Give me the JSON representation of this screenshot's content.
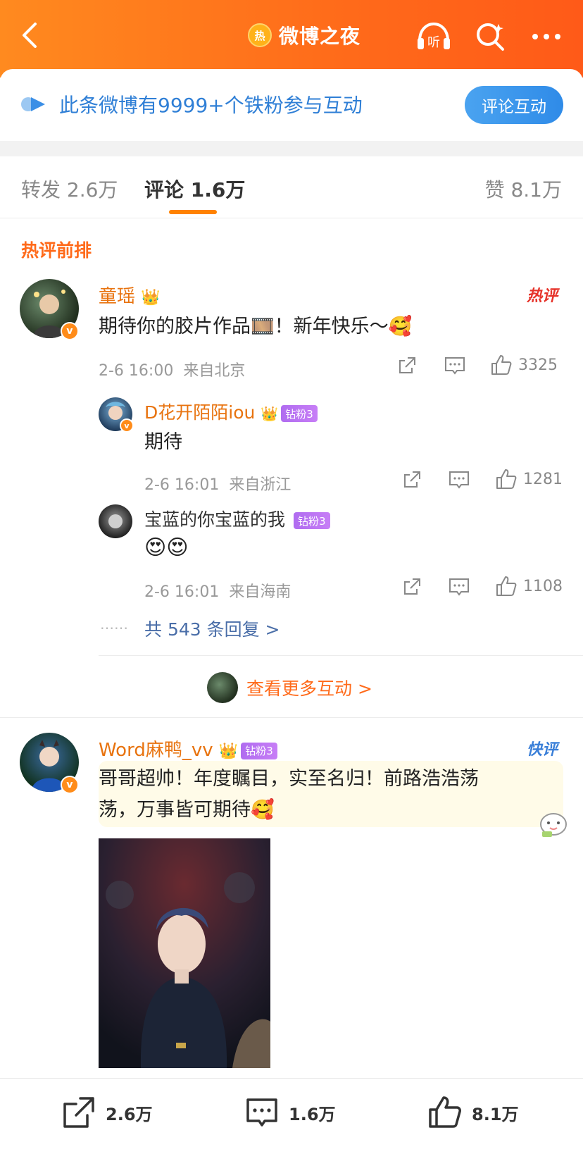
{
  "header": {
    "title": "微博之夜",
    "hot_badge": "热",
    "icons": [
      "back-icon",
      "listen-icon",
      "search-icon",
      "more-icon"
    ],
    "listen_label": "听"
  },
  "fans_banner": {
    "text": "此条微博有9999+个铁粉参与互动",
    "button": "评论互动"
  },
  "tabs": {
    "repost": "转发 2.6万",
    "comment": "评论 1.6万",
    "like": "赞 8.1万"
  },
  "section_title": "热评前排",
  "comments": [
    {
      "username": "童瑶",
      "text": "期待你的胶片作品🎞️！新年快乐～🥰",
      "time": "2-6 16:00",
      "location": "来自北京",
      "likes": "3325",
      "tag": "热评",
      "replies": [
        {
          "username": "D花开陌陌iou",
          "fan_level": "钻粉3",
          "text": "期待",
          "time": "2-6 16:01",
          "location": "来自浙江",
          "likes": "1281"
        },
        {
          "username": "宝蓝的你宝蓝的我",
          "fan_level": "钻粉3",
          "text": "😍😍",
          "time": "2-6 16:01",
          "location": "来自海南",
          "likes": "1108"
        }
      ],
      "more_replies": "共 543 条回复 >",
      "dots": "……"
    },
    {
      "username": "Word麻鸭_vv",
      "fan_level": "钻粉3",
      "tag": "快评",
      "text_line1": "哥哥超帅！年度瞩目，实至名归！前路浩浩荡",
      "text_line2": "荡，万事皆可期待🥰"
    }
  ],
  "see_more": "查看更多互动 >",
  "bottom_bar": {
    "repost": "2.6万",
    "comment": "1.6万",
    "like": "8.1万"
  },
  "colors": {
    "brand_orange": "#ff6a1a",
    "link_blue": "#2f7fd6",
    "fan_purple": "#b06cf0"
  }
}
